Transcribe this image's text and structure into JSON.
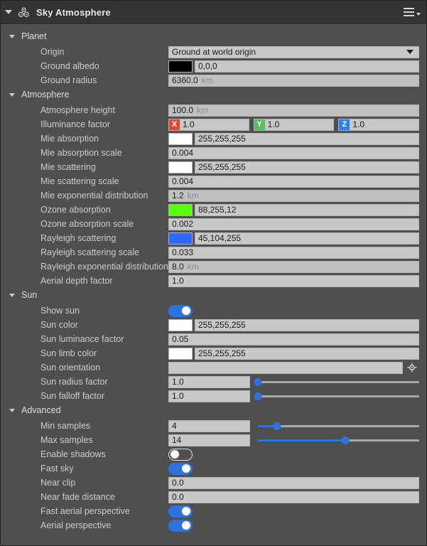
{
  "titlebar": {
    "title": "Sky Atmosphere",
    "collapse_icon": "triangle-down-icon",
    "node_icon": "sky-atmosphere-molecule-icon",
    "menu_icon": "hamburger-menu-icon",
    "menu_caret_icon": "chevron-down-icon"
  },
  "colors": {
    "accent": "#2c73e0",
    "axis_x": "#e04a3c",
    "axis_y": "#5bbd5b",
    "axis_z": "#2f7ef0",
    "panel_bg": "#4f4f4f",
    "titlebar_bg": "#333333",
    "field_bg": "#c8c8c8"
  },
  "sections": [
    {
      "id": "planet",
      "title": "Planet",
      "rows": [
        {
          "type": "dropdown",
          "label": "Origin",
          "value": "Ground at world origin"
        },
        {
          "type": "color",
          "label": "Ground albedo",
          "value": "0,0,0",
          "swatch": "#000000"
        },
        {
          "type": "text",
          "label": "Ground radius",
          "value": "6360.0",
          "unit": "km",
          "dim": true
        }
      ]
    },
    {
      "id": "atmosphere",
      "title": "Atmosphere",
      "rows": [
        {
          "type": "text",
          "label": "Atmosphere height",
          "value": "100.0",
          "unit": "km",
          "dim": true
        },
        {
          "type": "vector3",
          "label": "Illuminance factor",
          "x": "1.0",
          "y": "1.0",
          "z": "1.0",
          "axis_labels": [
            "X",
            "Y",
            "Z"
          ]
        },
        {
          "type": "color",
          "label": "Mie absorption",
          "value": "255,255,255",
          "swatch": "#ffffff"
        },
        {
          "type": "text",
          "label": "Mie absorption scale",
          "value": "0.004"
        },
        {
          "type": "color",
          "label": "Mie scattering",
          "value": "255,255,255",
          "swatch": "#ffffff"
        },
        {
          "type": "text",
          "label": "Mie scattering scale",
          "value": "0.004"
        },
        {
          "type": "text",
          "label": "Mie exponential distribution",
          "value": "1.2",
          "unit": "km",
          "dim": true
        },
        {
          "type": "color",
          "label": "Ozone absorption",
          "value": "88,255,12",
          "swatch": "#58ff0c"
        },
        {
          "type": "text",
          "label": "Ozone absorption scale",
          "value": "0.002"
        },
        {
          "type": "color",
          "label": "Rayleigh scattering",
          "value": "45,104,255",
          "swatch": "#2d68ff"
        },
        {
          "type": "text",
          "label": "Rayleigh scattering scale",
          "value": "0.033"
        },
        {
          "type": "text",
          "label": "Rayleigh exponential distribution",
          "value": "8.0",
          "unit": "km",
          "dim": true
        },
        {
          "type": "text",
          "label": "Aerial depth factor",
          "value": "1.0"
        }
      ]
    },
    {
      "id": "sun",
      "title": "Sun",
      "rows": [
        {
          "type": "toggle",
          "label": "Show sun",
          "value": "on"
        },
        {
          "type": "color",
          "label": "Sun color",
          "value": "255,255,255",
          "swatch": "#ffffff"
        },
        {
          "type": "text",
          "label": "Sun luminance factor",
          "value": "0.05"
        },
        {
          "type": "color",
          "label": "Sun limb color",
          "value": "255,255,255",
          "swatch": "#ffffff"
        },
        {
          "type": "orientation",
          "label": "Sun orientation",
          "value": "",
          "icon": "crosshair-target-icon"
        },
        {
          "type": "slider",
          "label": "Sun radius factor",
          "value": "1.0",
          "percent": 0
        },
        {
          "type": "slider",
          "label": "Sun falloff factor",
          "value": "1.0",
          "percent": 0
        }
      ]
    },
    {
      "id": "advanced",
      "title": "Advanced",
      "rows": [
        {
          "type": "slider",
          "label": "Min samples",
          "value": "4",
          "percent": 12
        },
        {
          "type": "slider",
          "label": "Max samples",
          "value": "14",
          "percent": 54
        },
        {
          "type": "toggle",
          "label": "Enable shadows",
          "value": "off"
        },
        {
          "type": "toggle",
          "label": "Fast sky",
          "value": "on"
        },
        {
          "type": "text",
          "label": "Near clip",
          "value": "0.0"
        },
        {
          "type": "text",
          "label": "Near fade distance",
          "value": "0.0"
        },
        {
          "type": "toggle",
          "label": "Fast aerial perspective",
          "value": "on"
        },
        {
          "type": "toggle",
          "label": "Aerial perspective",
          "value": "on"
        }
      ]
    }
  ]
}
